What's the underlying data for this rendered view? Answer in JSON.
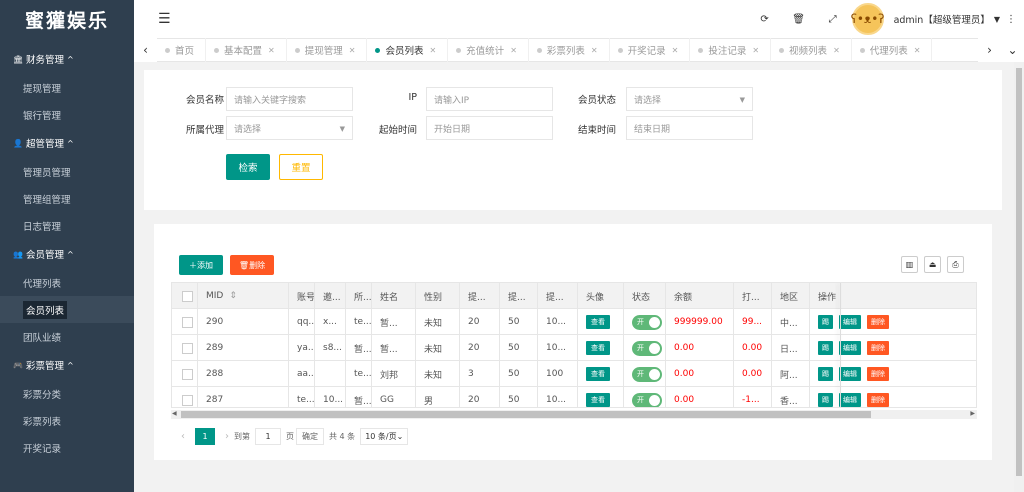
{
  "app": {
    "title": "蜜獾娱乐"
  },
  "sidebar": {
    "groups": [
      {
        "label": "财务管理",
        "icon": "bank-icon",
        "items": [
          "提现管理",
          "银行管理"
        ]
      },
      {
        "label": "超管管理",
        "icon": "user-icon",
        "items": [
          "管理员管理",
          "管理组管理",
          "日志管理"
        ]
      },
      {
        "label": "会员管理",
        "icon": "users-icon",
        "items": [
          "代理列表",
          "会员列表",
          "团队业绩"
        ]
      },
      {
        "label": "彩票管理",
        "icon": "gamepad-icon",
        "items": [
          "彩票分类",
          "彩票列表",
          "开奖记录"
        ]
      }
    ],
    "active_item": "会员列表"
  },
  "topbar": {
    "user": "admin【超级管理员】"
  },
  "tabs": [
    {
      "label": "首页",
      "active": false,
      "closable": false
    },
    {
      "label": "基本配置",
      "active": false,
      "closable": true
    },
    {
      "label": "提现管理",
      "active": false,
      "closable": true
    },
    {
      "label": "会员列表",
      "active": true,
      "closable": true
    },
    {
      "label": "充值统计",
      "active": false,
      "closable": true
    },
    {
      "label": "彩票列表",
      "active": false,
      "closable": true
    },
    {
      "label": "开奖记录",
      "active": false,
      "closable": true
    },
    {
      "label": "投注记录",
      "active": false,
      "closable": true
    },
    {
      "label": "视频列表",
      "active": false,
      "closable": true
    },
    {
      "label": "代理列表",
      "active": false,
      "closable": true
    }
  ],
  "filters": {
    "member_name": {
      "label": "会员名称",
      "placeholder": "请输入关键字搜索"
    },
    "ip": {
      "label": "IP",
      "placeholder": "请输入IP"
    },
    "status": {
      "label": "会员状态",
      "placeholder": "请选择"
    },
    "agent": {
      "label": "所属代理",
      "placeholder": "请选择"
    },
    "start": {
      "label": "起始时间",
      "placeholder": "开始日期"
    },
    "end": {
      "label": "结束时间",
      "placeholder": "结束日期"
    },
    "search_label": "检索",
    "reset_label": "重置"
  },
  "toolbar": {
    "add_label": "添加",
    "delete_label": "删除"
  },
  "table": {
    "headers": [
      "",
      "MID",
      "账号",
      "邀...",
      "所...",
      "姓名",
      "性别",
      "提...",
      "提...",
      "提...",
      "头像",
      "状态",
      "余额",
      "打...",
      "地区",
      "操作"
    ],
    "view_label": "查看",
    "switch_label": "开",
    "ops": [
      "踢",
      "编辑",
      "删除"
    ],
    "rows": [
      [
        "",
        "290",
        "qq...",
        "x...",
        "te...",
        "暂...",
        "未知",
        "20",
        "50",
        "10...",
        "",
        "",
        "999999.00",
        "99...",
        "中...",
        ""
      ],
      [
        "",
        "289",
        "ya...",
        "s8...",
        "暂...",
        "暂...",
        "未知",
        "20",
        "50",
        "10...",
        "",
        "",
        "0.00",
        "0.00",
        "日...",
        ""
      ],
      [
        "",
        "288",
        "aa...",
        "",
        "te...",
        "刘邦",
        "未知",
        "3",
        "50",
        "100",
        "",
        "",
        "0.00",
        "0.00",
        "阿...",
        ""
      ],
      [
        "",
        "287",
        "te...",
        "10...",
        "暂...",
        "GG",
        "男",
        "20",
        "50",
        "10...",
        "",
        "",
        "0.00",
        "-1...",
        "香...",
        ""
      ]
    ]
  },
  "pagination": {
    "current": "1",
    "goto_label": "到第",
    "page_input": "1",
    "page_unit": "页",
    "confirm_label": "确定",
    "total_label": "共 4 条",
    "page_size": "10 条/页"
  }
}
